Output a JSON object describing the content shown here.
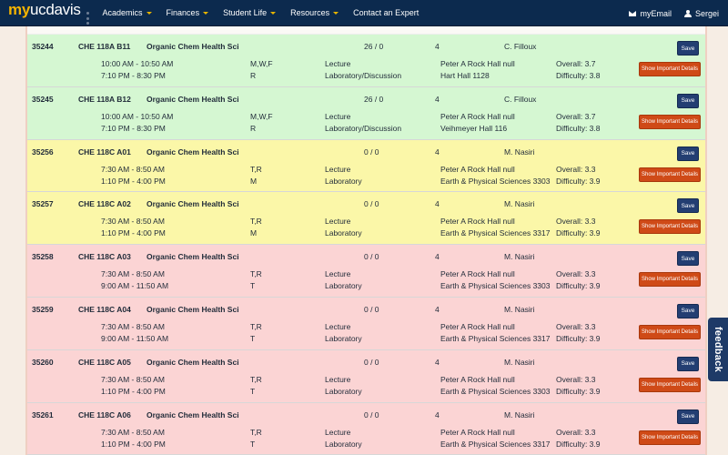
{
  "brand": {
    "my": "my",
    "rest": "ucdavis"
  },
  "nav": {
    "items": [
      {
        "label": "Academics",
        "dropdown": true
      },
      {
        "label": "Finances",
        "dropdown": true
      },
      {
        "label": "Student Life",
        "dropdown": true
      },
      {
        "label": "Resources",
        "dropdown": true
      },
      {
        "label": "Contact an Expert",
        "dropdown": false
      }
    ],
    "email_label": "myEmail",
    "user_label": "Sergei"
  },
  "buttons": {
    "save": "Save",
    "details": "Show Important Details"
  },
  "feedback_label": "feedback",
  "colors": {
    "open": "#d5f7d2",
    "waitlist": "#fbf7a8",
    "closed": "#fbd4d4",
    "navbar": "#0c2a4e",
    "save": "#233e72",
    "details": "#cf4a17"
  },
  "courses": [
    {
      "crn": "35244",
      "course": "CHE 118A B11",
      "title": "Organic Chem Health Sci",
      "seats": "26 / 0",
      "units": "4",
      "instructor": "C. Filloux",
      "time1": "10:00 AM - 10:50 AM",
      "days1": "M,W,F",
      "type1": "Lecture",
      "loc1": "Peter A Rock Hall null",
      "time2": "7:10 PM - 8:30 PM",
      "days2": "R",
      "type2": "Laboratory/Discussion",
      "loc2": "Hart Hall 1128",
      "overall": "Overall: 3.7",
      "difficulty": "Difficulty: 3.8",
      "status": "green"
    },
    {
      "crn": "35245",
      "course": "CHE 118A B12",
      "title": "Organic Chem Health Sci",
      "seats": "26 / 0",
      "units": "4",
      "instructor": "C. Filloux",
      "time1": "10:00 AM - 10:50 AM",
      "days1": "M,W,F",
      "type1": "Lecture",
      "loc1": "Peter A Rock Hall null",
      "time2": "7:10 PM - 8:30 PM",
      "days2": "R",
      "type2": "Laboratory/Discussion",
      "loc2": "Veihmeyer Hall 116",
      "overall": "Overall: 3.7",
      "difficulty": "Difficulty: 3.8",
      "status": "green"
    },
    {
      "crn": "35256",
      "course": "CHE 118C A01",
      "title": "Organic Chem Health Sci",
      "seats": "0 / 0",
      "units": "4",
      "instructor": "M. Nasiri",
      "time1": "7:30 AM - 8:50 AM",
      "days1": "T,R",
      "type1": "Lecture",
      "loc1": "Peter A Rock Hall null",
      "time2": "1:10 PM - 4:00 PM",
      "days2": "M",
      "type2": "Laboratory",
      "loc2": "Earth & Physical Sciences 3303",
      "overall": "Overall: 3.3",
      "difficulty": "Difficulty: 3.9",
      "status": "yellow"
    },
    {
      "crn": "35257",
      "course": "CHE 118C A02",
      "title": "Organic Chem Health Sci",
      "seats": "0 / 0",
      "units": "4",
      "instructor": "M. Nasiri",
      "time1": "7:30 AM - 8:50 AM",
      "days1": "T,R",
      "type1": "Lecture",
      "loc1": "Peter A Rock Hall null",
      "time2": "1:10 PM - 4:00 PM",
      "days2": "M",
      "type2": "Laboratory",
      "loc2": "Earth & Physical Sciences 3317",
      "overall": "Overall: 3.3",
      "difficulty": "Difficulty: 3.9",
      "status": "yellow"
    },
    {
      "crn": "35258",
      "course": "CHE 118C A03",
      "title": "Organic Chem Health Sci",
      "seats": "0 / 0",
      "units": "4",
      "instructor": "M. Nasiri",
      "time1": "7:30 AM - 8:50 AM",
      "days1": "T,R",
      "type1": "Lecture",
      "loc1": "Peter A Rock Hall null",
      "time2": "9:00 AM - 11:50 AM",
      "days2": "T",
      "type2": "Laboratory",
      "loc2": "Earth & Physical Sciences 3303",
      "overall": "Overall: 3.3",
      "difficulty": "Difficulty: 3.9",
      "status": "red"
    },
    {
      "crn": "35259",
      "course": "CHE 118C A04",
      "title": "Organic Chem Health Sci",
      "seats": "0 / 0",
      "units": "4",
      "instructor": "M. Nasiri",
      "time1": "7:30 AM - 8:50 AM",
      "days1": "T,R",
      "type1": "Lecture",
      "loc1": "Peter A Rock Hall null",
      "time2": "9:00 AM - 11:50 AM",
      "days2": "T",
      "type2": "Laboratory",
      "loc2": "Earth & Physical Sciences 3317",
      "overall": "Overall: 3.3",
      "difficulty": "Difficulty: 3.9",
      "status": "red"
    },
    {
      "crn": "35260",
      "course": "CHE 118C A05",
      "title": "Organic Chem Health Sci",
      "seats": "0 / 0",
      "units": "4",
      "instructor": "M. Nasiri",
      "time1": "7:30 AM - 8:50 AM",
      "days1": "T,R",
      "type1": "Lecture",
      "loc1": "Peter A Rock Hall null",
      "time2": "1:10 PM - 4:00 PM",
      "days2": "T",
      "type2": "Laboratory",
      "loc2": "Earth & Physical Sciences 3303",
      "overall": "Overall: 3.3",
      "difficulty": "Difficulty: 3.9",
      "status": "red"
    },
    {
      "crn": "35261",
      "course": "CHE 118C A06",
      "title": "Organic Chem Health Sci",
      "seats": "0 / 0",
      "units": "4",
      "instructor": "M. Nasiri",
      "time1": "7:30 AM - 8:50 AM",
      "days1": "T,R",
      "type1": "Lecture",
      "loc1": "Peter A Rock Hall null",
      "time2": "1:10 PM - 4:00 PM",
      "days2": "T",
      "type2": "Laboratory",
      "loc2": "Earth & Physical Sciences 3317",
      "overall": "Overall: 3.3",
      "difficulty": "Difficulty: 3.9",
      "status": "red"
    }
  ]
}
